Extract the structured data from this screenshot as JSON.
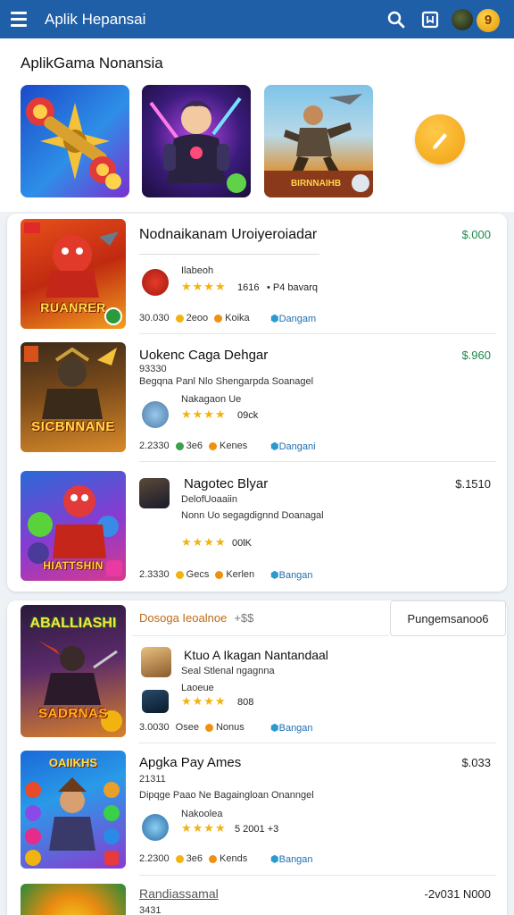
{
  "header": {
    "title": "Aplik Hepansai",
    "icons": [
      "menu-icon",
      "search-icon",
      "bookmark-icon",
      "avatar",
      "coin-icon"
    ],
    "coin_label": "9"
  },
  "featured": {
    "title": "AplikGama Nonansia"
  },
  "list1": [
    {
      "title": "Nodnaikanam Uroiyeroiadar",
      "price": "$.000",
      "sub1": "Ilabeoh",
      "rating": "1616",
      "rating_extra": "• P4 bavarq",
      "thumb_label": "RUANRER",
      "foot_num": "30.030",
      "foot_mid": "2eoo",
      "foot_dev": "Koika",
      "link": "Dangam"
    },
    {
      "title": "Uokenc Caga Dehgar",
      "price": "$.960",
      "sub1": "93330",
      "sub2": "Begqna Panl Nlo Shengarpda Soanagel",
      "sub3": "Nakagaon Ue",
      "rating": "09ck",
      "thumb_label": "SICBNNANE",
      "foot_num": "2.2330",
      "foot_mid": "3e6",
      "foot_dev": "Kenes",
      "link": "Dangani"
    },
    {
      "title": "Nagotec Blyar",
      "price": "$.1510",
      "sub1": "DelofUoaaiin",
      "sub2": "Nonn Uo segagdignnd Doanagal",
      "rating": "00lK",
      "thumb_label": "HIATTSHIN",
      "foot_num": "2.3330",
      "foot_mid": "Gecs",
      "foot_dev": "Kerlen",
      "link": "Bangan"
    }
  ],
  "tabs": {
    "tab_a": "Dosoga Ieoalnoe",
    "tab_a_extra": "+$$",
    "tab_b": "Pungemsanoo6"
  },
  "list2": [
    {
      "title": "Ktuo A Ikagan Nantandaal",
      "sub1": "Seal Stlenal ngagnna",
      "sub2": "Laoeue",
      "rating": "808",
      "thumb_label_top": "ABALLIASHI",
      "thumb_label": "SADRNAS",
      "foot_num": "3.0030",
      "foot_mid": "Osee",
      "foot_dev": "Nonus",
      "link": "Bangan"
    },
    {
      "title": "Apgka Pay Ames",
      "price": "$.033",
      "sub1": "21311",
      "sub2": "Dipqge Paao Ne Bagaingloan Onanngel",
      "sub3": "Nakoolea",
      "rating": "5 2001 +3",
      "thumb_label": "OAIIKHS",
      "foot_num": "2.2300",
      "foot_mid": "3e6",
      "foot_dev": "Kends",
      "link": "Bangan"
    },
    {
      "title": "Randiassamal",
      "price": "-2v031 N000",
      "sub1": "3431"
    }
  ],
  "colors": {
    "header_bg": "#1f5fa8",
    "price_green": "#1a8a4a",
    "link_blue": "#1f6fb0",
    "star_gold": "#f1b310",
    "tab_orange": "#c06a10"
  }
}
